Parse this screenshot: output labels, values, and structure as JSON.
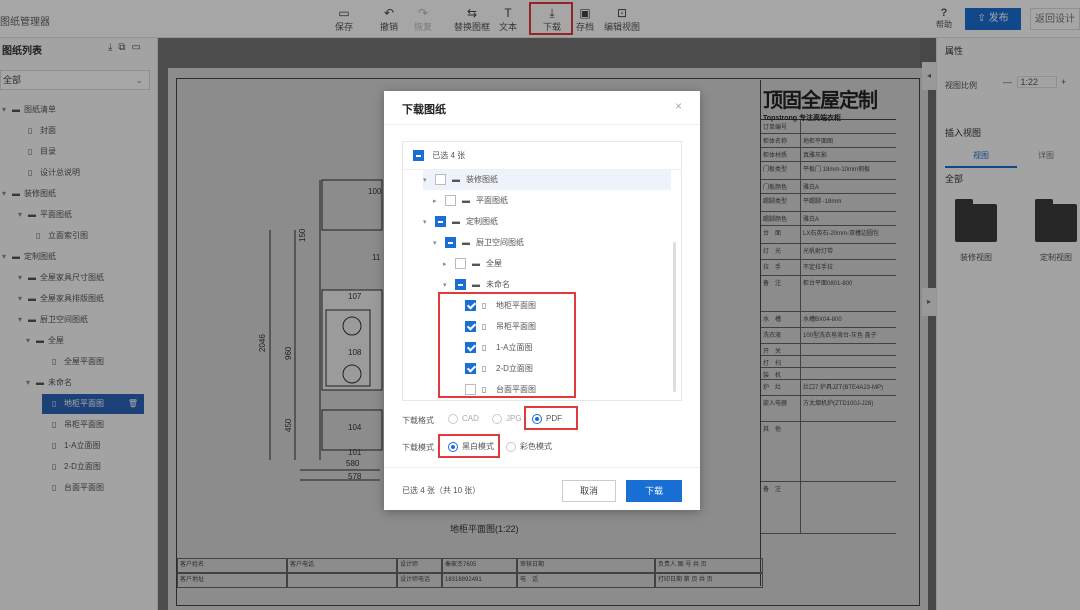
{
  "app": {
    "name": "图纸管理器"
  },
  "toolbar": {
    "items": [
      {
        "label": "保存",
        "icon": "save-icon"
      },
      {
        "label": "撤销",
        "icon": "undo-icon"
      },
      {
        "label": "恢复",
        "icon": "redo-icon"
      },
      {
        "label": "替换图框",
        "icon": "frame-icon"
      },
      {
        "label": "文本",
        "icon": "text-icon"
      },
      {
        "label": "下载",
        "icon": "download-icon"
      },
      {
        "label": "存档",
        "icon": "archive-icon"
      },
      {
        "label": "编辑视图",
        "icon": "edit-view-icon"
      }
    ],
    "help_label": "帮助",
    "publish_label": "发布",
    "back_label": "返回设计"
  },
  "left_panel": {
    "title": "图纸列表",
    "filter": "全部",
    "tree": [
      {
        "label": "图纸清单",
        "level": 0
      },
      {
        "label": "封面",
        "level": 1
      },
      {
        "label": "目录",
        "level": 1
      },
      {
        "label": "设计总说明",
        "level": 1
      },
      {
        "label": "装修图纸",
        "level": 0
      },
      {
        "label": "平面图纸",
        "level": 1
      },
      {
        "label": "立面索引图",
        "level": 2
      },
      {
        "label": "定制图纸",
        "level": 0
      },
      {
        "label": "全屋家具尺寸图纸",
        "level": 1
      },
      {
        "label": "全屋家具排版图纸",
        "level": 1
      },
      {
        "label": "厨卫空间图纸",
        "level": 1
      },
      {
        "label": "全屋",
        "level": 2
      },
      {
        "label": "全屋平面图",
        "level": 3
      },
      {
        "label": "未命名",
        "level": 2
      },
      {
        "label": "地柜平面图",
        "level": 3
      },
      {
        "label": "吊柜平面图",
        "level": 3
      },
      {
        "label": "1-A立面图",
        "level": 3
      },
      {
        "label": "2-D立面图",
        "level": 3
      },
      {
        "label": "台面平面图",
        "level": 3
      }
    ]
  },
  "drawing": {
    "title": "地柜平面图(1:22)",
    "dims": [
      "100",
      "150",
      "107",
      "2046",
      "960",
      "450",
      "578",
      "580",
      "101",
      "104",
      "108",
      "11"
    ],
    "title_block": {
      "logo_main": "顶固全屋定制",
      "logo_sub": "Topstrong 专注高端衣柜",
      "rows": [
        {
          "k": "订单编号",
          "v": ""
        },
        {
          "k": "柜体名称",
          "v": "地柜平面图"
        },
        {
          "k": "柜体材质",
          "v": "真雅灰影"
        },
        {
          "k": "门板类型",
          "v": "平板门 18mm-10mm钢板"
        },
        {
          "k": "门板颜色",
          "v": "雅白A"
        },
        {
          "k": "踢脚类型",
          "v": "平踢脚 -18mm"
        },
        {
          "k": "踢脚颜色",
          "v": "雅白A"
        },
        {
          "k": "台　面",
          "v": "LX石英石-20mm-双槽边圆包"
        },
        {
          "k": "灯　光",
          "v": "光帆射灯带"
        },
        {
          "k": "拉　手",
          "v": "不定拉手拉"
        },
        {
          "k": "备　注",
          "v": "柜台平面0801-800"
        },
        {
          "k": "水　槽",
          "v": "水槽BX04-800"
        },
        {
          "k": "洗衣液",
          "v": "100型洗衣皂液台-灰色 盖子"
        },
        {
          "k": "开　关",
          "v": ""
        },
        {
          "k": "打　扫",
          "v": ""
        },
        {
          "k": "装　机",
          "v": ""
        },
        {
          "k": "炉　灶",
          "v": "灶口7 炉具JZT(BTE4A23-MP)"
        },
        {
          "k": "嵌入电器",
          "v": "方太烟机炉(ZTD100J-J28)"
        },
        {
          "k": "其　他",
          "v": ""
        },
        {
          "k": "备　注",
          "v": ""
        }
      ]
    },
    "bottom": [
      "客户姓名",
      "客户电话",
      "设计师",
      "秦家杰7605",
      "审核日期",
      "负责人 图 号 共 页",
      "客户地址",
      "",
      "设计师电话",
      "18318892491",
      "电　话",
      "打印日期 第 页 共 页"
    ]
  },
  "right_panel": {
    "properties_title": "属性",
    "scale_label": "视图比例",
    "scale_value": "1:22",
    "insert_title": "插入视图",
    "tabs": [
      "视图",
      "详图"
    ],
    "filter": "全部",
    "folders": [
      "装修视图",
      "定制视图"
    ]
  },
  "modal": {
    "title": "下载图纸",
    "selected_header": "已选 4 张",
    "tree": [
      {
        "label": "装修图纸",
        "indent": 1,
        "arrow": "▾",
        "state": "unchecked",
        "icon": "folder"
      },
      {
        "label": "平面图纸",
        "indent": 2,
        "arrow": "▸",
        "state": "unchecked",
        "icon": "folder"
      },
      {
        "label": "定制图纸",
        "indent": 1,
        "arrow": "▾",
        "state": "partial",
        "icon": "folder"
      },
      {
        "label": "厨卫空间图纸",
        "indent": 2,
        "arrow": "▾",
        "state": "partial",
        "icon": "folder"
      },
      {
        "label": "全屋",
        "indent": 3,
        "arrow": "▸",
        "state": "unchecked",
        "icon": "folder"
      },
      {
        "label": "未命名",
        "indent": 3,
        "arrow": "▾",
        "state": "partial",
        "icon": "folder"
      },
      {
        "label": "地柜平面图",
        "indent": 4,
        "arrow": "",
        "state": "checked",
        "icon": "file"
      },
      {
        "label": "吊柜平面图",
        "indent": 4,
        "arrow": "",
        "state": "checked",
        "icon": "file"
      },
      {
        "label": "1-A立面图",
        "indent": 4,
        "arrow": "",
        "state": "checked",
        "icon": "file"
      },
      {
        "label": "2-D立面图",
        "indent": 4,
        "arrow": "",
        "state": "checked",
        "icon": "file"
      },
      {
        "label": "台面平面图",
        "indent": 4,
        "arrow": "",
        "state": "unchecked",
        "icon": "file"
      }
    ],
    "format_label": "下载格式",
    "formats": [
      {
        "label": "CAD",
        "selected": false
      },
      {
        "label": "JPG",
        "selected": false
      },
      {
        "label": "PDF",
        "selected": true
      }
    ],
    "mode_label": "下载模式",
    "modes": [
      {
        "label": "黑白模式",
        "selected": true
      },
      {
        "label": "彩色模式",
        "selected": false
      }
    ],
    "summary": "已选 4 张（共 10 张）",
    "cancel_label": "取消",
    "download_label": "下载"
  },
  "colors": {
    "accent": "#1a6fd4",
    "highlight": "#e03a3a",
    "selected_row": "#2b63b8"
  }
}
